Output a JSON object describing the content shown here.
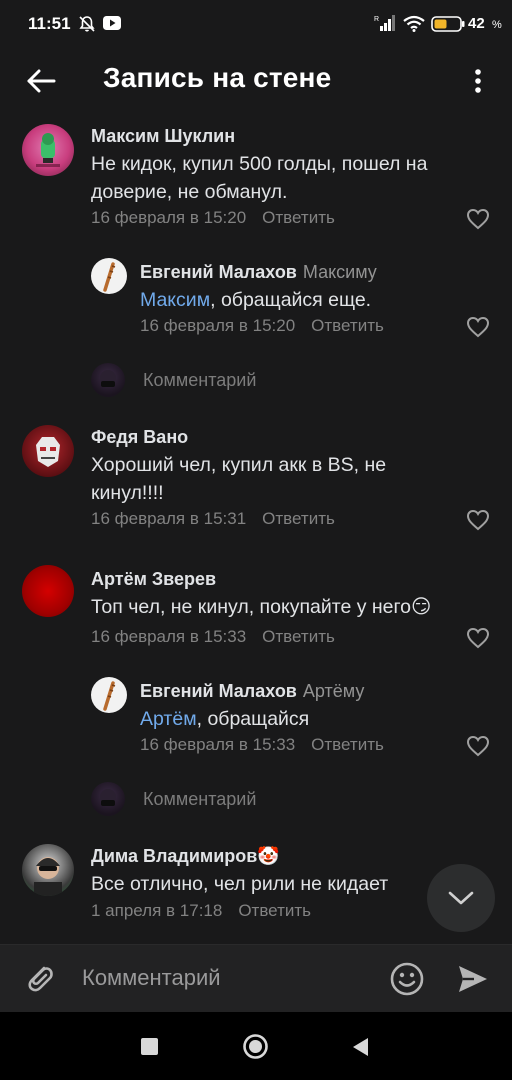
{
  "status_bar": {
    "time": "11:51",
    "battery_pct": "42",
    "battery_unit": "%"
  },
  "header": {
    "title": "Запись на стене"
  },
  "comments": [
    {
      "author": "Максим Шуклин",
      "text": "Не кидок, купил 500 голды, пошел на доверие, не обманул.",
      "date": "16 февраля в 15:20",
      "reply_label": "Ответить"
    },
    {
      "author": "Евгений Малахов",
      "reply_to": "Максиму",
      "mention": "Максим",
      "text_rest": ", обращайся еще.",
      "date": "16 февраля в 15:20",
      "reply_label": "Ответить"
    },
    {
      "author": "Федя Вано",
      "text": "Хороший чел, купил акк в BS, не кинул!!!!",
      "date": "16 февраля в 15:31",
      "reply_label": "Ответить"
    },
    {
      "author": "Артём Зверев",
      "text": "Топ чел, не кинул, покупайте у него",
      "emoji": "😏",
      "date": "16 февраля в 15:33",
      "reply_label": "Ответить"
    },
    {
      "author": "Евгений Малахов",
      "reply_to": "Артёму",
      "mention": "Артём",
      "text_rest": ", обращайся",
      "date": "16 февраля в 15:33",
      "reply_label": "Ответить"
    },
    {
      "author": "Дима Владимиров",
      "author_emoji": "🤡",
      "text": "Все отлично, чел рили не кидает",
      "date": "1 апреля в 17:18",
      "reply_label": "Ответить"
    }
  ],
  "add_comment_label": "Комментарий",
  "composer": {
    "placeholder": "Комментарий"
  },
  "colors": {
    "background": "#19191a",
    "link": "#71aaeb",
    "meta": "#828282"
  },
  "icons": [
    "back-arrow-icon",
    "more-vertical-icon",
    "heart-icon",
    "chevron-down-icon",
    "paperclip-icon",
    "emoji-smile-icon",
    "send-icon",
    "nav-square-icon",
    "nav-circle-icon",
    "nav-back-triangle-icon"
  ]
}
